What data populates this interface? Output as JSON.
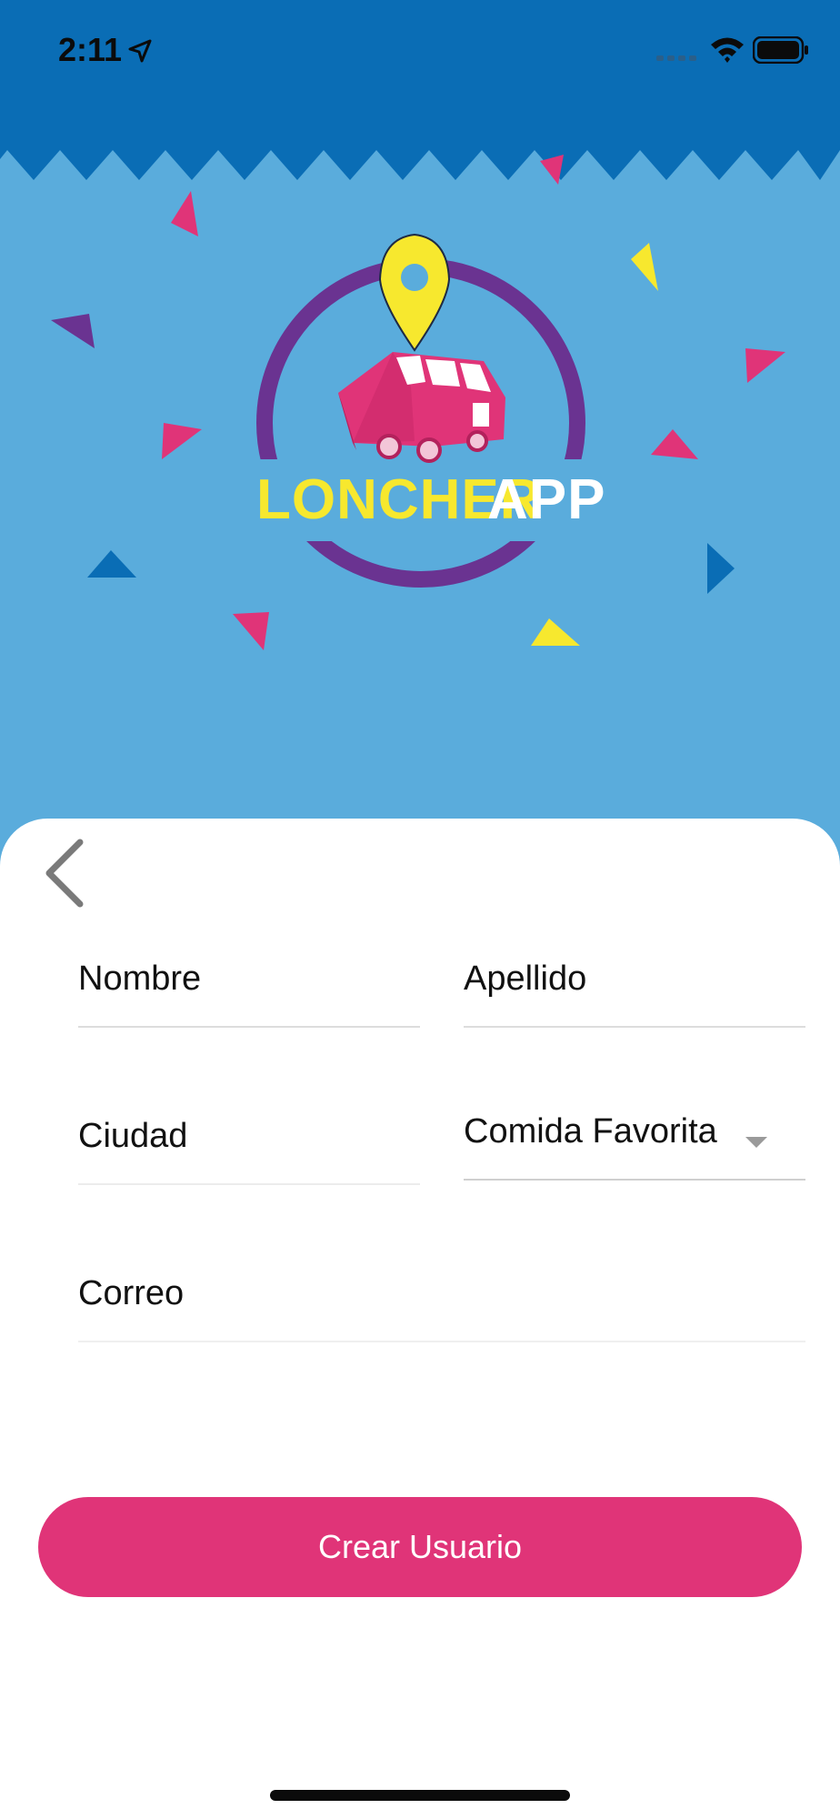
{
  "status_bar": {
    "time": "2:11"
  },
  "logo": {
    "brand_part1": "LONCHER",
    "brand_part2": "APP"
  },
  "form": {
    "first_name_label": "Nombre",
    "last_name_label": "Apellido",
    "city_label": "Ciudad",
    "favorite_food_label": "Comida Favorita",
    "email_label": "Correo",
    "submit_label": "Crear Usuario"
  },
  "colors": {
    "header_blue": "#0a6db5",
    "sky_blue": "#5aacdc",
    "brand_pink": "#e03478",
    "brand_purple": "#6a3391",
    "brand_yellow": "#f7e82e"
  },
  "icons": {
    "back": "chevron-left-icon",
    "dropdown": "caret-down-icon",
    "location": "location-arrow-icon",
    "wifi": "wifi-icon",
    "battery": "battery-icon"
  }
}
